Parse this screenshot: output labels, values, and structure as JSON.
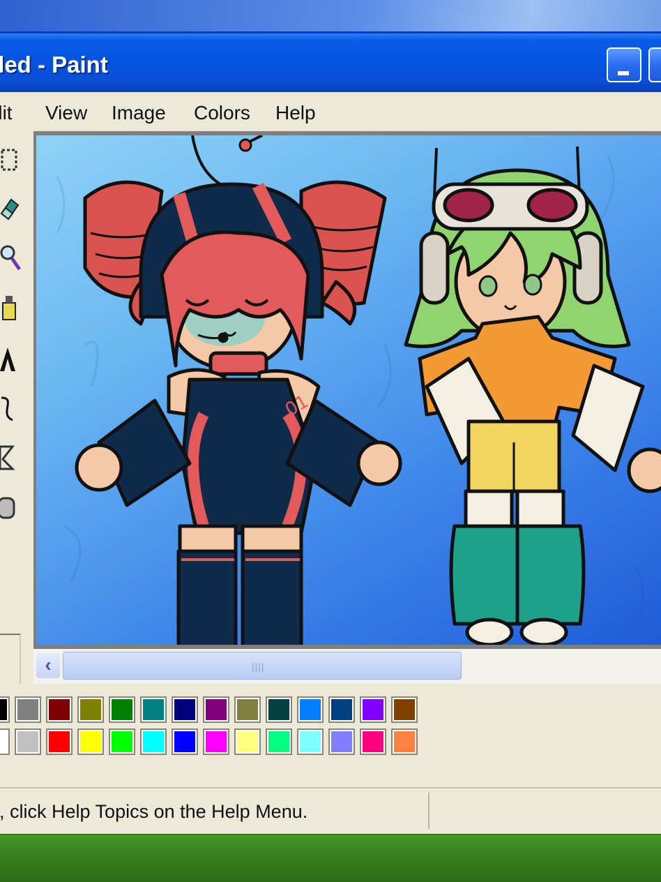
{
  "window": {
    "title": "titled - Paint"
  },
  "menu": [
    {
      "label": "dit"
    },
    {
      "label": "View"
    },
    {
      "label": "Image"
    },
    {
      "label": "Colors"
    },
    {
      "label": "Help"
    }
  ],
  "tools": [
    "select-rect-icon",
    "eraser-icon",
    "magnifier-icon",
    "fill-bucket-icon",
    "text-icon",
    "curve-icon",
    "polygon-icon",
    "rounded-rect-icon"
  ],
  "palette": {
    "top_row": [
      "#000000",
      "#808080",
      "#800000",
      "#808000",
      "#008000",
      "#008080",
      "#000080",
      "#800080",
      "#808040",
      "#004040",
      "#0080ff",
      "#004080",
      "#8000ff",
      "#804000"
    ],
    "bottom_row": [
      "#ffffff",
      "#c0c0c0",
      "#ff0000",
      "#ffff00",
      "#00ff00",
      "#00ffff",
      "#0000ff",
      "#ff00ff",
      "#ffff80",
      "#00ff80",
      "#80ffff",
      "#8080ff",
      "#ff0080",
      "#ff8040"
    ]
  },
  "status": {
    "text": "o, click Help Topics on the Help Menu."
  },
  "scrollbar": {
    "left_arrow": "‹",
    "grip": "||||"
  }
}
